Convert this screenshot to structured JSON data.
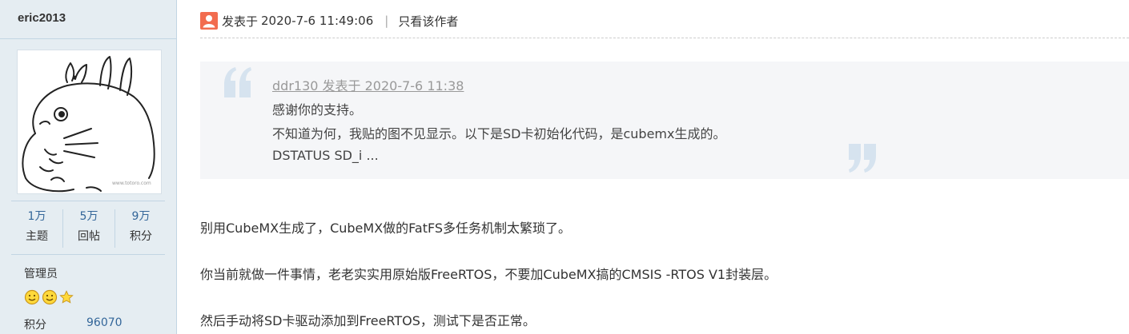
{
  "sidebar": {
    "username": "eric2013",
    "stats": [
      {
        "value": "1万",
        "label": "主题"
      },
      {
        "value": "5万",
        "label": "回帖"
      },
      {
        "value": "9万",
        "label": "积分"
      }
    ],
    "user_group": "管理员",
    "medals": [
      "smiley-medal-icon",
      "smiley-medal-icon",
      "star-medal-icon"
    ],
    "credit_label": "积分",
    "credit_value": "96070"
  },
  "post_header": {
    "posted_prefix": "发表于",
    "post_date": "2020-7-6 11:49:06",
    "separator": "|",
    "only_author_label": "只看该作者"
  },
  "quote": {
    "author_line": "ddr130 发表于 2020-7-6 11:38",
    "lines": [
      "感谢你的支持。",
      "不知道为何，我贴的图不见显示。以下是SD卡初始化代码，是cubemx生成的。",
      "DSTATUS SD_i ..."
    ]
  },
  "post_body": [
    "别用CubeMX生成了，CubeMX做的FatFS多任务机制太繁琐了。",
    "你当前就做一件事情，老老实实用原始版FreeRTOS，不要加CubeMX搞的CMSIS -RTOS V1封装层。",
    "然后手动将SD卡驱动添加到FreeRTOS，测试下是否正常。"
  ],
  "colors": {
    "sidebar_bg": "#e5edf2",
    "link_blue": "#336699",
    "quote_bg": "#f5f6f8",
    "quote_mark": "#d6e3ef",
    "author_icon": "#f26c4f"
  }
}
